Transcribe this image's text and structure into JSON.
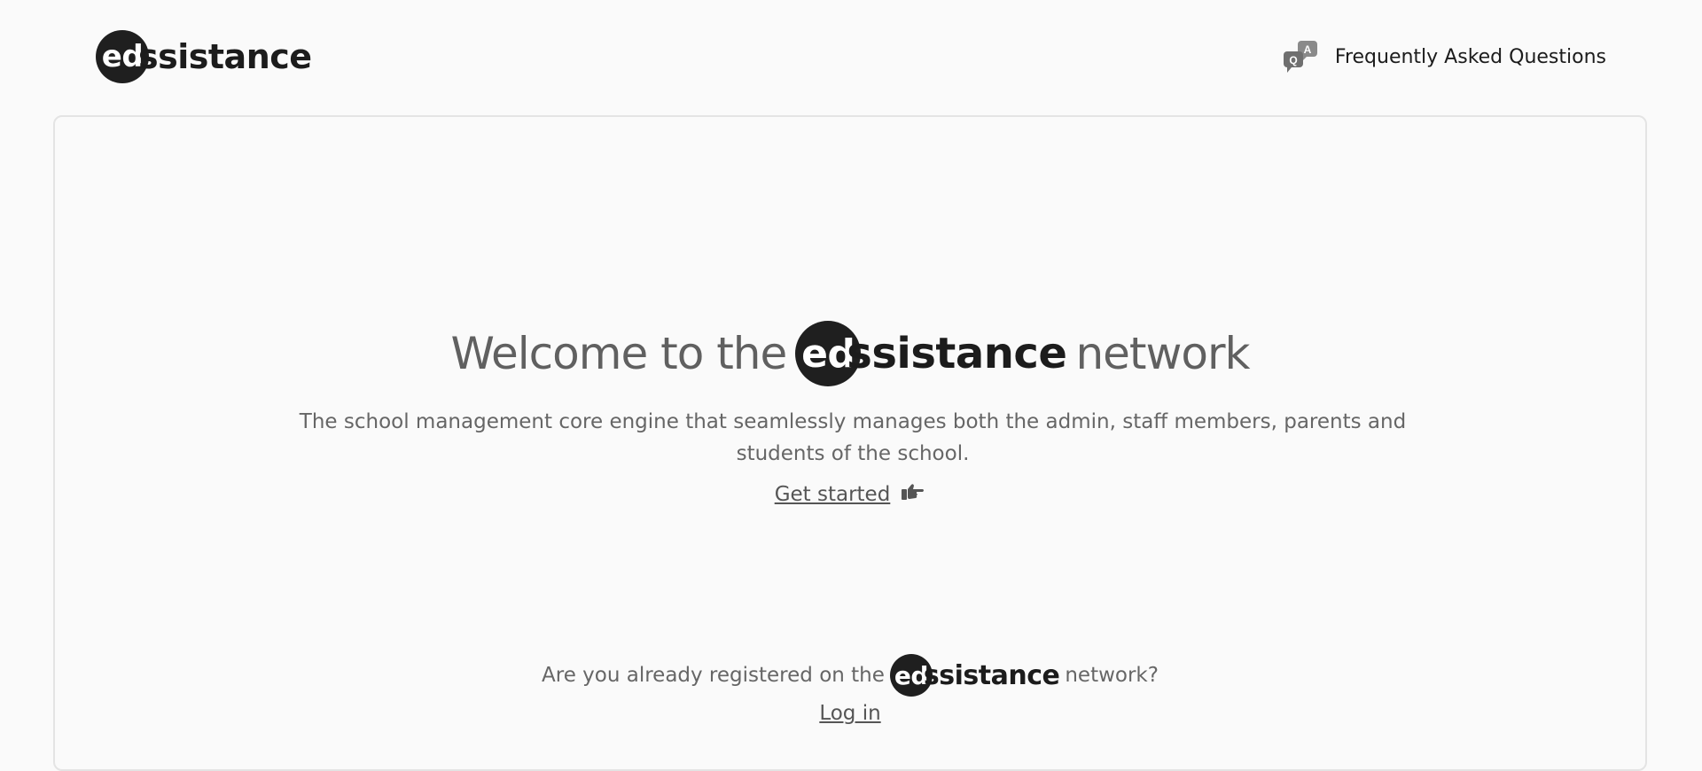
{
  "brand": {
    "badge": "ed",
    "rest": "ssistance"
  },
  "header": {
    "faq_label": "Frequently Asked Questions",
    "faq_icon": "qa-chat-icon"
  },
  "hero": {
    "prefix": "Welcome to the",
    "suffix": "network",
    "subtitle": "The school management core engine that seamlessly manages both the admin, staff members, parents and students of the school.",
    "cta_label": "Get started",
    "cta_icon": "hand-pointing-right-icon"
  },
  "registered": {
    "prefix": "Are you already registered on the",
    "suffix": "network?",
    "login_label": "Log in"
  },
  "colors": {
    "badge": "#1f1f1f",
    "text": "#666666",
    "background": "#fafafa"
  }
}
